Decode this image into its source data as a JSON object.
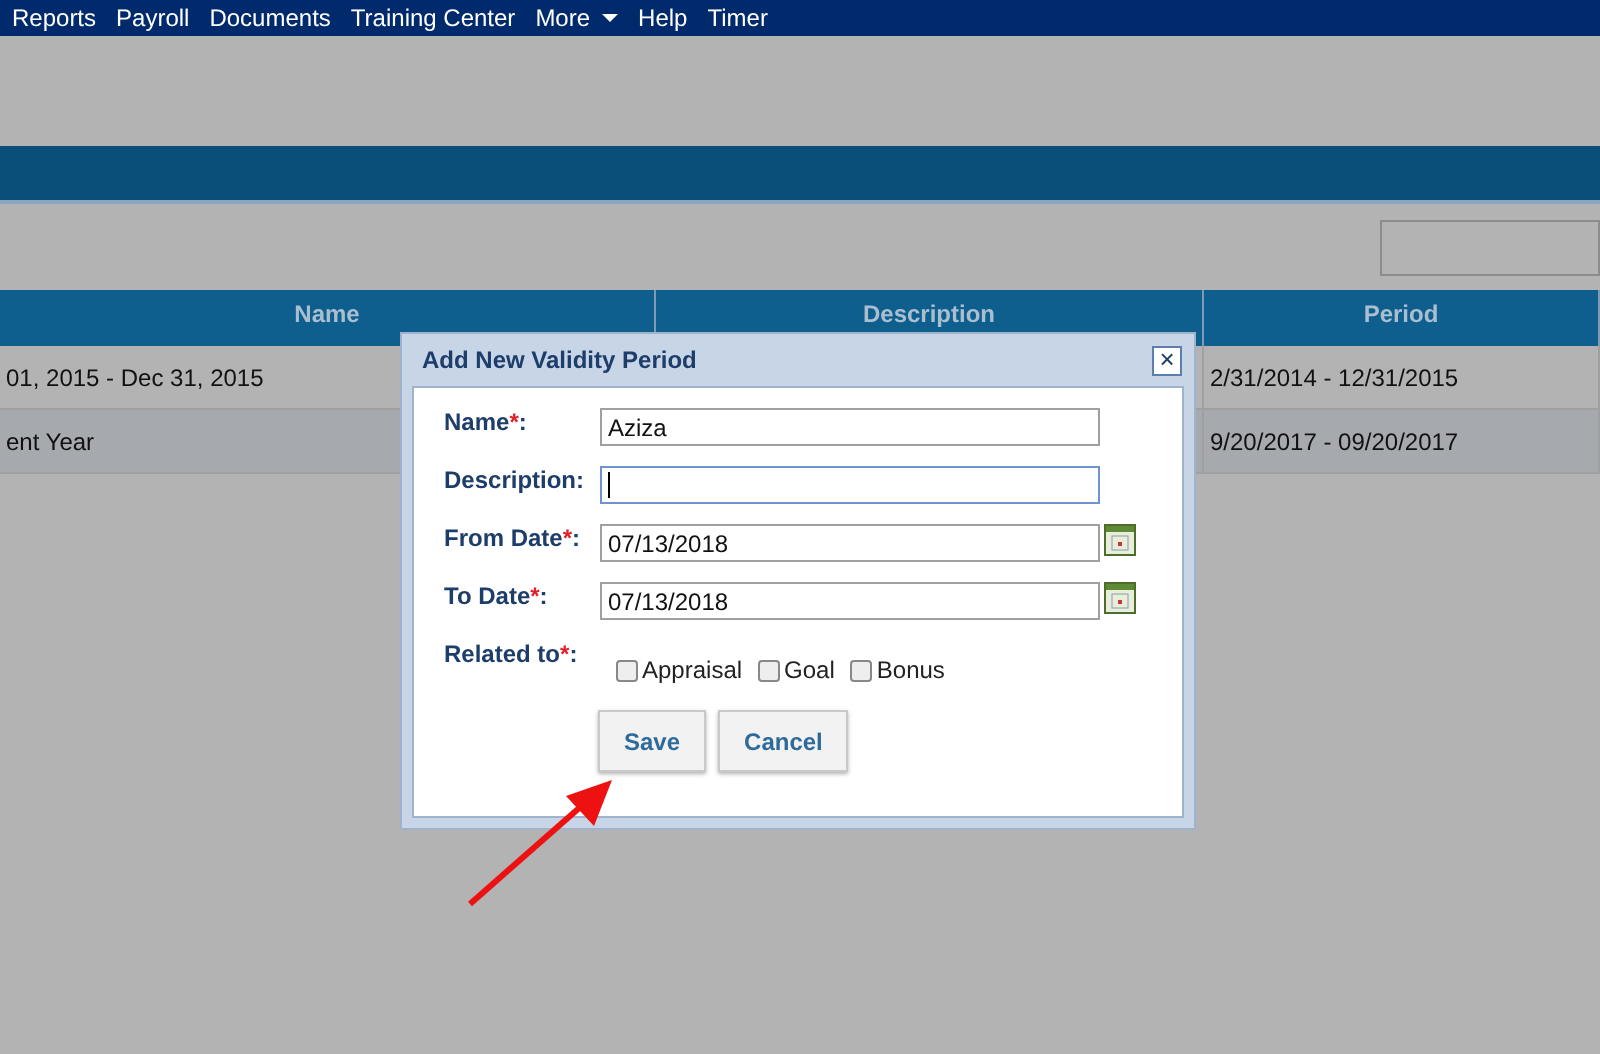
{
  "nav": {
    "items": [
      {
        "label": "Reports",
        "dropdown": false
      },
      {
        "label": "Payroll",
        "dropdown": false
      },
      {
        "label": "Documents",
        "dropdown": false
      },
      {
        "label": "Training Center",
        "dropdown": false
      },
      {
        "label": "More",
        "dropdown": true
      },
      {
        "label": "Help",
        "dropdown": false
      },
      {
        "label": "Timer",
        "dropdown": false
      }
    ]
  },
  "table": {
    "columns": [
      "Name",
      "Description",
      "Period"
    ],
    "rows": [
      {
        "cells": [
          "01, 2015 - Dec 31, 2015",
          "",
          "2/31/2014 - 12/31/2015"
        ],
        "selected": false
      },
      {
        "cells": [
          "ent Year",
          "",
          "9/20/2017 - 09/20/2017"
        ],
        "selected": true
      }
    ]
  },
  "dialog": {
    "title": "Add New Validity Period",
    "close": "×",
    "fields": [
      {
        "kind": "text",
        "label": "Name",
        "mark": "*",
        "colon": ":",
        "value": "Aziza",
        "focused": false
      },
      {
        "kind": "text",
        "label": "Description",
        "colon": ":",
        "focused": true
      },
      {
        "kind": "date",
        "label": "From Date",
        "mark": "*",
        "colon": ":",
        "value": "07/13/2018",
        "focused": false
      },
      {
        "kind": "date",
        "label": "To Date",
        "mark": "*",
        "colon": ":",
        "value": "07/13/2018",
        "focused": false
      }
    ],
    "related": {
      "label": "Related to",
      "mark": "*",
      "colon": ":",
      "options": [
        {
          "label": "Appraisal",
          "checked": false
        },
        {
          "label": "Goal",
          "checked": false
        },
        {
          "label": "Bonus",
          "checked": false
        }
      ]
    },
    "buttons": [
      "Save",
      "Cancel"
    ]
  }
}
